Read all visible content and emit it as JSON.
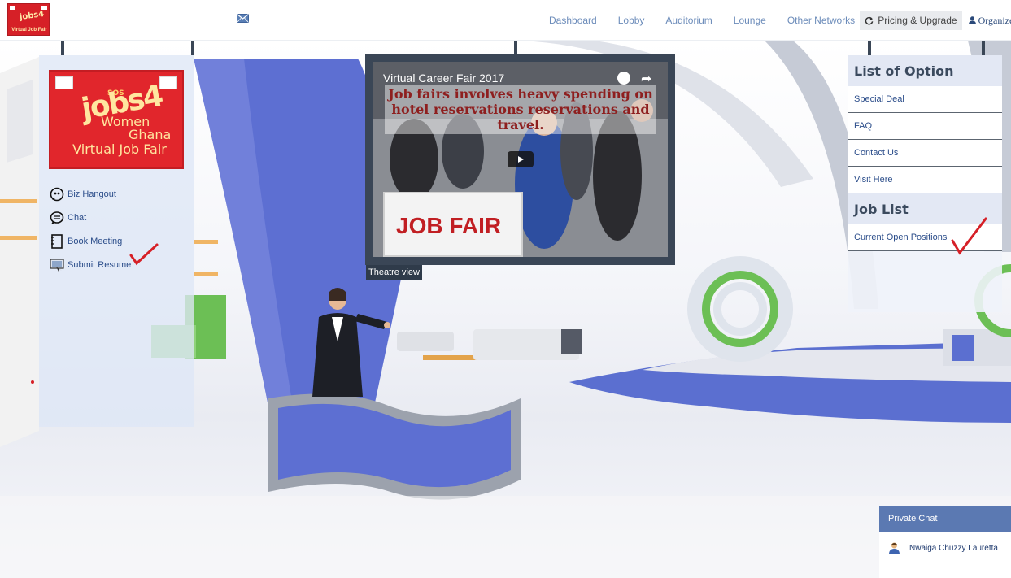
{
  "topnav": {
    "logo": {
      "line1": "jobs4",
      "line2": "Virtual Job Fair"
    },
    "mail_icon": "envelope-icon",
    "links": [
      "Dashboard",
      "Lobby",
      "Auditorium",
      "Lounge",
      "Other Networks"
    ],
    "pricing": {
      "label": "Pricing & Upgrade",
      "icon": "refresh-icon"
    },
    "organizer": {
      "label": "Organizer",
      "icon": "user-icon"
    }
  },
  "booth": {
    "brand": {
      "sos": "SOS",
      "jobs": "jobs4",
      "women": "Women",
      "ghana": "Ghana",
      "fair": "Virtual Job Fair"
    },
    "menu": [
      {
        "label": "Biz Hangout",
        "icon": "quote-bubble-icon"
      },
      {
        "label": "Chat",
        "icon": "chat-bubble-icon"
      },
      {
        "label": "Book Meeting",
        "icon": "notebook-icon"
      },
      {
        "label": "Submit Resume",
        "icon": "resume-upload-icon"
      }
    ]
  },
  "video": {
    "title": "Virtual Career Fair 2017",
    "overlay_text": "Job fairs involves heavy spending on hotel reservations reservations and travel.",
    "sign_text": "JOB FAIR",
    "theatre_label": "Theatre view"
  },
  "options": {
    "heading": "List of Option",
    "links": [
      "Special Deal",
      "FAQ",
      "Contact Us",
      "Visit Here"
    ],
    "job_heading": "Job List",
    "job_links": [
      "Current Open Positions"
    ]
  },
  "private_chat": {
    "title": "Private Chat",
    "user": "Nwaiga Chuzzy Lauretta"
  },
  "colors": {
    "brand_red": "#e1262c",
    "stage_blue": "#5b6fd0",
    "link_blue": "#2b4d8a",
    "chat_header": "#5b79b2"
  }
}
